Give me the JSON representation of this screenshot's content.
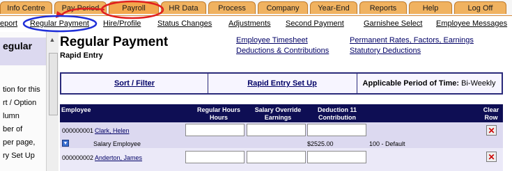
{
  "tabs": [
    {
      "label": "Info Centre"
    },
    {
      "label": "Pay Period"
    },
    {
      "label": "Payroll"
    },
    {
      "label": "HR Data"
    },
    {
      "label": "Process"
    },
    {
      "label": "Company"
    },
    {
      "label": "Year-End"
    },
    {
      "label": "Reports"
    },
    {
      "label": "Help"
    },
    {
      "label": "Log Off"
    }
  ],
  "subnav": [
    {
      "label": "eport"
    },
    {
      "label": "Regular Payment"
    },
    {
      "label": "Hire/Profile"
    },
    {
      "label": "Status Changes"
    },
    {
      "label": "Adjustments"
    },
    {
      "label": "Second Payment"
    },
    {
      "label": "Garnishee Select"
    },
    {
      "label": "Employee Messages"
    }
  ],
  "left_panel": {
    "header": "egular",
    "lines": [
      "tion for this",
      "rt / Option",
      "lumn",
      "ber of",
      "per page,",
      "ry Set Up"
    ]
  },
  "page": {
    "title": "Regular Payment",
    "subtitle": "Rapid Entry"
  },
  "links": [
    {
      "label": "Employee Timesheet"
    },
    {
      "label": "Deductions & Contributions"
    },
    {
      "label": "Permanent Rates, Factors, Earnings"
    },
    {
      "label": "Statutory Deductions"
    }
  ],
  "action_bar": {
    "sort_filter": "Sort / Filter",
    "rapid_entry_setup": "Rapid Entry Set Up",
    "period_label": "Applicable Period of Time:",
    "period_value": "Bi-Weekly"
  },
  "table": {
    "col_employee": "Employee",
    "col_hours_1": "Regular Hours",
    "col_hours_2": "Hours",
    "col_salary_1": "Salary Override",
    "col_salary_2": "Earnings",
    "col_ded_1": "Deduction 11",
    "col_ded_2": "Contribution",
    "col_clear_1": "Clear",
    "col_clear_2": "Row",
    "rows": [
      {
        "id": "000000001",
        "name": "Clark, Helen",
        "type": "Salary Employee",
        "amount": "$2525.00",
        "default": "100 - Default"
      },
      {
        "id": "000000002",
        "name": "Anderton, James"
      }
    ]
  },
  "colors": {
    "tab_orange": "#f0b260",
    "navy": "#0e0e54",
    "row_lavender": "#dcd9f0",
    "highlight_red": "#e02020",
    "highlight_blue": "#1f2fd8"
  },
  "icons": {
    "clear_row": "close-icon",
    "expand": "expand-icon",
    "scroll_up": "arrow-up-icon"
  }
}
